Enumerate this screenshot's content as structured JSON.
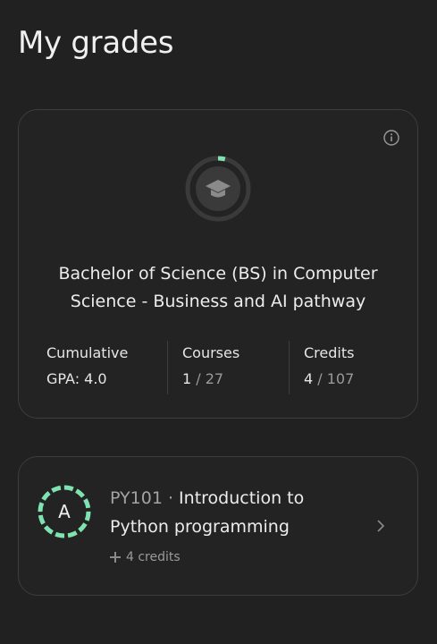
{
  "page": {
    "title": "My grades"
  },
  "program": {
    "title": "Bachelor of Science (BS) in Computer Science - Business and AI pathway",
    "progress_fraction": 0.037,
    "icon": "graduation-cap-icon",
    "stats": [
      {
        "label": "Cumulative",
        "value": "GPA: 4.0"
      },
      {
        "label": "Courses",
        "value_done": "1",
        "value_total": " / 27"
      },
      {
        "label": "Credits",
        "value_done": "4",
        "value_total": " / 107"
      }
    ]
  },
  "courses": [
    {
      "grade": "A",
      "code": "PY101",
      "separator": " · ",
      "name": "Introduction to Python programming",
      "credits": "4 credits"
    }
  ],
  "colors": {
    "accent": "#7ee3b0",
    "ring_track": "#3a3a3a",
    "card_border": "#3d3d3d",
    "background": "#212121"
  }
}
